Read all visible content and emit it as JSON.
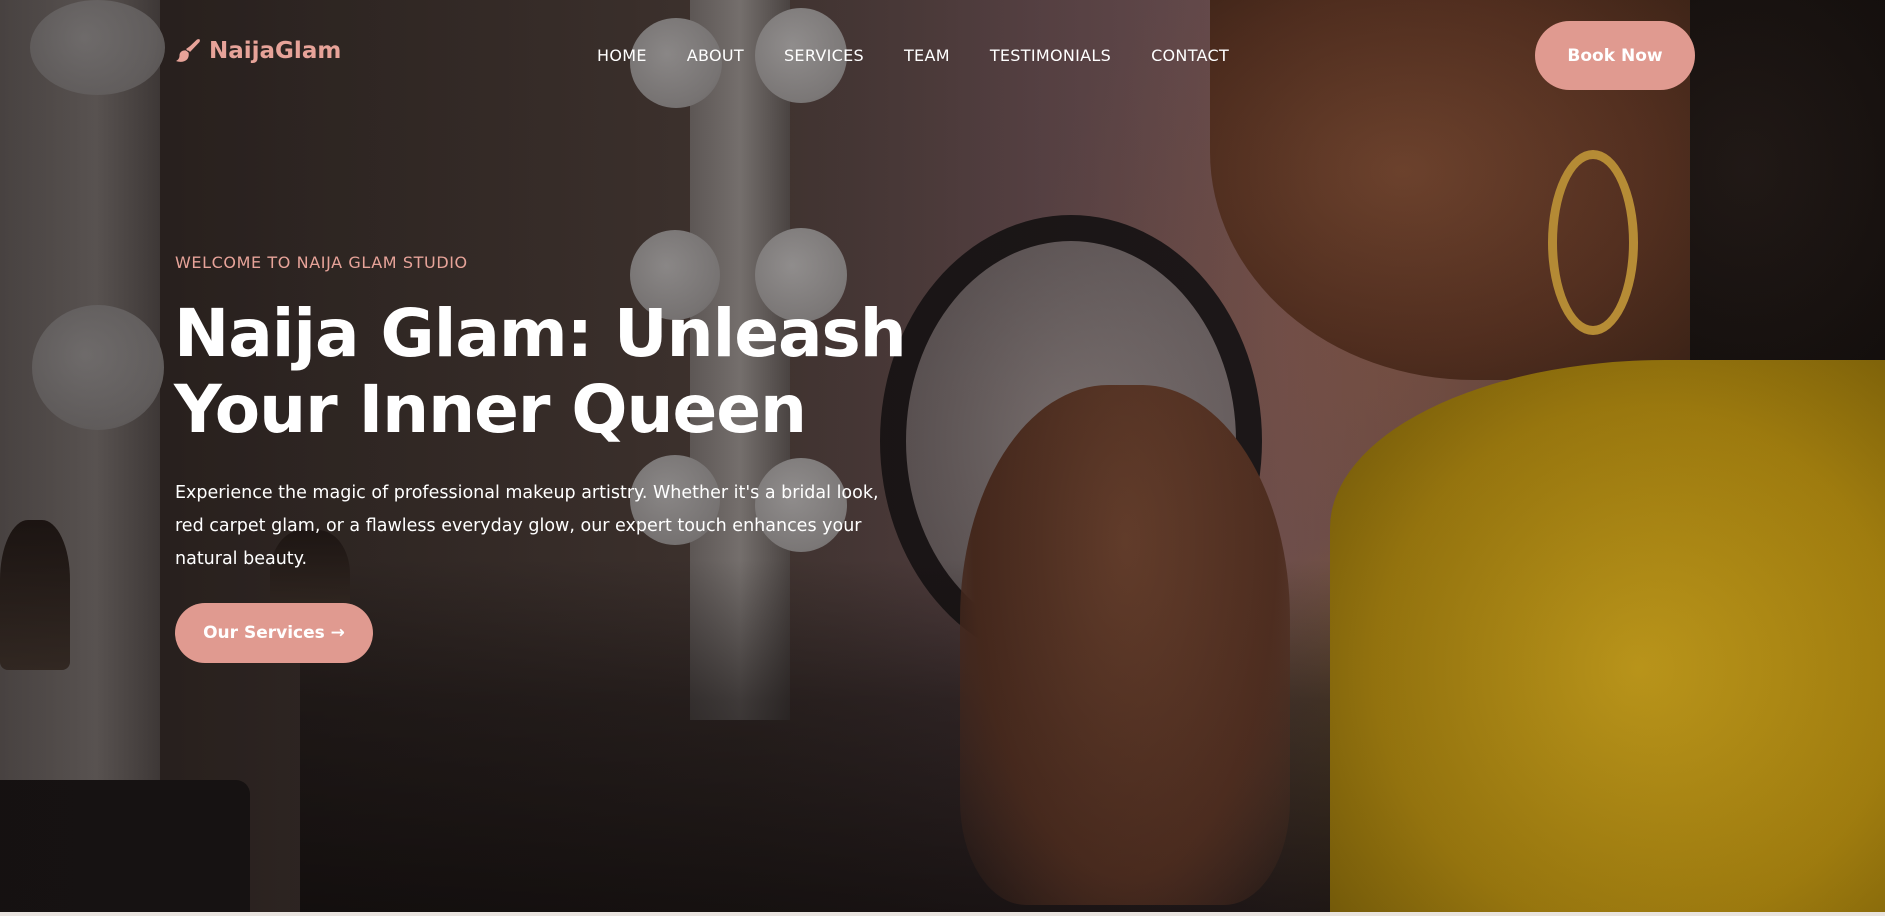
{
  "brand": {
    "name": "NaijaGlam",
    "icon": "makeup-brush-icon",
    "accent_color": "#e09a90"
  },
  "nav": {
    "items": [
      {
        "label": "HOME"
      },
      {
        "label": "ABOUT"
      },
      {
        "label": "SERVICES"
      },
      {
        "label": "TEAM"
      },
      {
        "label": "TESTIMONIALS"
      },
      {
        "label": "CONTACT"
      }
    ],
    "cta_label": "Book Now"
  },
  "hero": {
    "eyebrow": "WELCOME TO NAIJA GLAM STUDIO",
    "headline": "Naija Glam: Unleash Your Inner Queen",
    "description": "Experience the magic of professional makeup artistry. Whether it's a bridal look, red carpet glam, or a flawless everyday glow, our expert touch enhances your natural beauty.",
    "button_label": "Our Services →"
  }
}
